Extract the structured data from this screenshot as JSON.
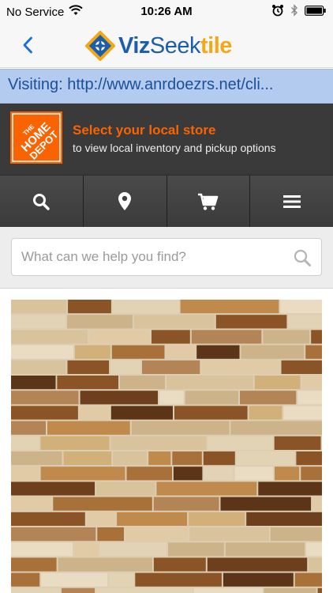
{
  "status_bar": {
    "carrier": "No Service",
    "time": "10:26 AM",
    "icons": [
      "wifi-icon",
      "alarm-icon",
      "bluetooth-icon",
      "battery-icon"
    ]
  },
  "app_nav": {
    "back_icon": "chevron-left-icon",
    "logo": {
      "part1": "Viz",
      "part2": "Seek",
      "part3": "tile"
    }
  },
  "visiting": {
    "text": "Visiting: http://www.anrdoezrs.net/cli..."
  },
  "store_banner": {
    "logo_text": "THE HOME DEPOT",
    "title": "Select your local store",
    "subtitle": "to view local inventory and pickup options"
  },
  "toolbar": {
    "buttons": [
      {
        "icon": "search-icon"
      },
      {
        "icon": "location-pin-icon"
      },
      {
        "icon": "cart-icon"
      },
      {
        "icon": "menu-icon"
      }
    ]
  },
  "search": {
    "placeholder": "What can we help you find?",
    "value": ""
  },
  "product": {
    "image": "mosaic-tile-image"
  },
  "colors": {
    "brand_blue": "#1d5ea8",
    "brand_yellow": "#f3a81a",
    "home_depot_orange": "#f96302",
    "visiting_bg": "#b3cbef",
    "toolbar_bg": "#3a3a3a"
  }
}
